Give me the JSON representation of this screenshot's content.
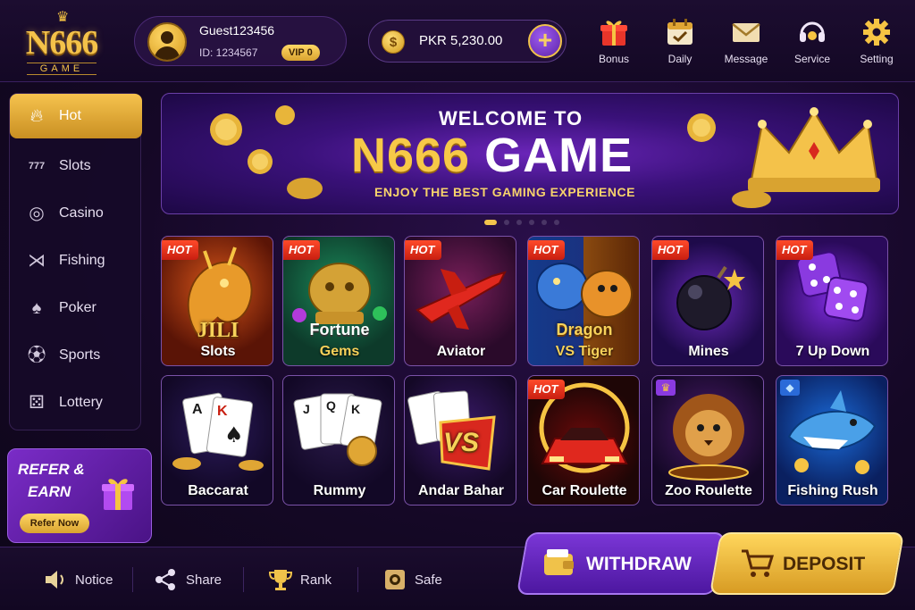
{
  "header": {
    "logo_main": "N666",
    "logo_sub": "GAME",
    "user": {
      "name": "Guest123456",
      "id": "ID: 1234567",
      "vip": "VIP 0"
    },
    "balance": "PKR 5,230.00",
    "nav": [
      {
        "label": "Bonus",
        "icon": "gift-icon"
      },
      {
        "label": "Daily",
        "icon": "calendar-check-icon"
      },
      {
        "label": "Message",
        "icon": "envelope-icon"
      },
      {
        "label": "Service",
        "icon": "headset-icon"
      },
      {
        "label": "Setting",
        "icon": "gear-icon"
      }
    ]
  },
  "sidebar": {
    "items": [
      {
        "label": "Hot",
        "icon": "flame-icon"
      },
      {
        "label": "Slots",
        "icon": "slot-777-icon"
      },
      {
        "label": "Casino",
        "icon": "chip-icon"
      },
      {
        "label": "Fishing",
        "icon": "fish-icon"
      },
      {
        "label": "Poker",
        "icon": "spade-icon"
      },
      {
        "label": "Sports",
        "icon": "ball-icon"
      },
      {
        "label": "Lottery",
        "icon": "dice-icon"
      }
    ],
    "active": "Hot"
  },
  "refer": {
    "line1": "REFER &",
    "line2": "EARN",
    "button": "Refer Now"
  },
  "banner": {
    "line1": "WELCOME TO",
    "title_gold": "N666",
    "title_white": "GAME",
    "tagline": "ENJOY THE BEST GAMING EXPERIENCE",
    "slides": 6,
    "active_slide": 1
  },
  "games": [
    {
      "name": "Slots",
      "badge": "HOT",
      "overlay": "JILI"
    },
    {
      "name": "Gems",
      "badge": "HOT",
      "overlay": "Fortune"
    },
    {
      "name": "Aviator",
      "badge": "HOT",
      "overlay": ""
    },
    {
      "name": "VS Tiger",
      "badge": "HOT",
      "overlay": "Dragon"
    },
    {
      "name": "Mines",
      "badge": "HOT",
      "overlay": ""
    },
    {
      "name": "7 Up Down",
      "badge": "HOT",
      "overlay": ""
    },
    {
      "name": "Baccarat",
      "badge": "",
      "overlay": ""
    },
    {
      "name": "Rummy",
      "badge": "",
      "overlay": ""
    },
    {
      "name": "Andar Bahar",
      "badge": "",
      "overlay": "VS"
    },
    {
      "name": "Car Roulette",
      "badge": "HOT",
      "overlay": ""
    },
    {
      "name": "Zoo Roulette",
      "badge": "",
      "overlay": ""
    },
    {
      "name": "Fishing Rush",
      "badge": "",
      "overlay": ""
    }
  ],
  "bottom": {
    "nav": [
      {
        "label": "Notice",
        "icon": "speaker-icon"
      },
      {
        "label": "Share",
        "icon": "share-icon"
      },
      {
        "label": "Rank",
        "icon": "trophy-icon"
      },
      {
        "label": "Safe",
        "icon": "safe-icon"
      }
    ],
    "withdraw": "WITHDRAW",
    "deposit": "DEPOSIT"
  },
  "colors": {
    "gold": "#f4c24a",
    "purple": "#5e23a8",
    "hot_red": "#e02a18",
    "bg": "#150826"
  }
}
